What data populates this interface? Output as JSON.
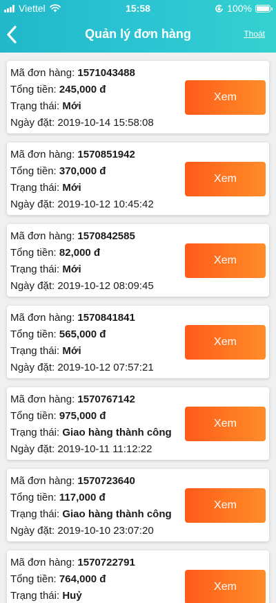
{
  "status_bar": {
    "carrier": "Viettel",
    "time": "15:58",
    "battery": "100%"
  },
  "header": {
    "title": "Quản lý đơn hàng",
    "logout": "Thoát"
  },
  "labels": {
    "order_id": "Mã đơn hàng: ",
    "total": "Tổng tiền: ",
    "status": "Trạng thái: ",
    "date": "Ngày đặt: "
  },
  "orders": [
    {
      "id": "1571043488",
      "total": "245,000 đ",
      "status": "Mới",
      "date": "2019-10-14 15:58:08",
      "button": "Xem"
    },
    {
      "id": "1570851942",
      "total": "370,000 đ",
      "status": "Mới",
      "date": "2019-10-12 10:45:42",
      "button": "Xem"
    },
    {
      "id": "1570842585",
      "total": "82,000 đ",
      "status": "Mới",
      "date": "2019-10-12 08:09:45",
      "button": "Xem"
    },
    {
      "id": "1570841841",
      "total": "565,000 đ",
      "status": "Mới",
      "date": "2019-10-12 07:57:21",
      "button": "Xem"
    },
    {
      "id": "1570767142",
      "total": "975,000 đ",
      "status": "Giao hàng thành công",
      "date": "2019-10-11 11:12:22",
      "button": "Xem"
    },
    {
      "id": "1570723640",
      "total": "117,000 đ",
      "status": "Giao hàng thành công",
      "date": "2019-10-10 23:07:20",
      "button": "Xem"
    },
    {
      "id": "1570722791",
      "total": "764,000 đ",
      "status": "Huỷ",
      "date": "",
      "button": "Xem"
    }
  ],
  "icons": {
    "back": "chevron-left-icon",
    "signal": "signal-bars-icon",
    "wifi": "wifi-icon",
    "lock": "rotation-lock-icon",
    "battery": "battery-icon"
  }
}
